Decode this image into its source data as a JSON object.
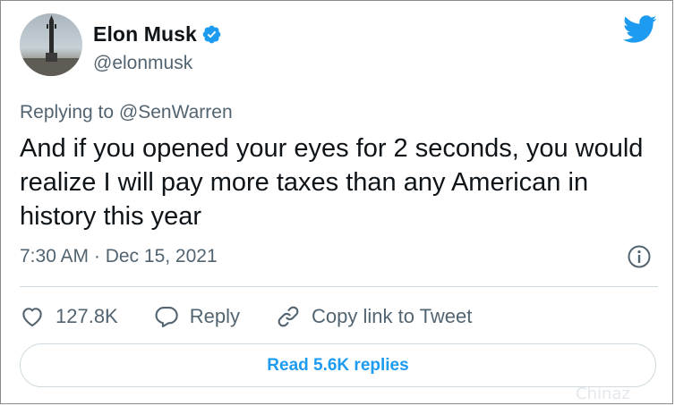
{
  "author": {
    "name": "Elon Musk",
    "handle": "@elonmusk",
    "verified": true
  },
  "reply_context": {
    "prefix": "Replying to ",
    "mention": "@SenWarren"
  },
  "tweet": {
    "text": "And if you opened your eyes for 2 seconds, you would realize I will pay more taxes than any American in history this year",
    "timestamp": "7:30 AM · Dec 15, 2021"
  },
  "actions": {
    "likes_count": "127.8K",
    "reply_label": "Reply",
    "copy_link_label": "Copy link to Tweet"
  },
  "read_replies_label": "Read 5.6K replies",
  "watermark": "Chinaz",
  "colors": {
    "accent": "#1d9bf0",
    "secondary_text": "#536471",
    "primary_text": "#0f1419",
    "border": "#cfd9de"
  },
  "icons": [
    "verified-badge-icon",
    "twitter-bird-icon",
    "info-icon",
    "heart-icon",
    "reply-bubble-icon",
    "link-icon"
  ]
}
